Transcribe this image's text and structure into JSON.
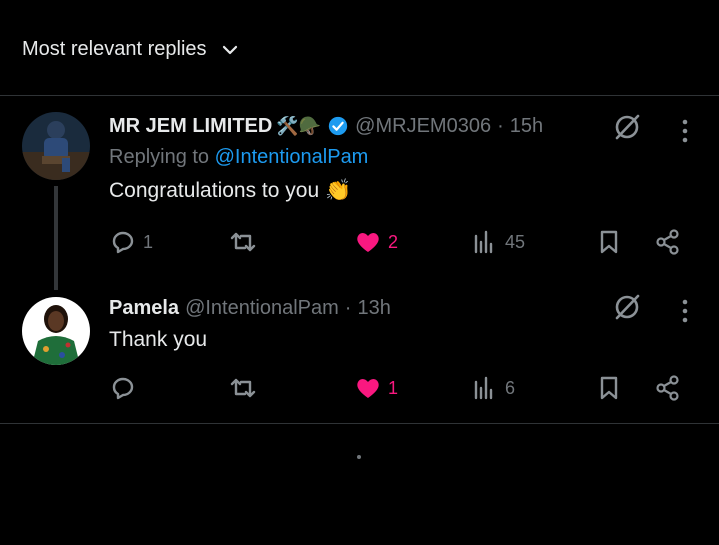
{
  "sort": {
    "label": "Most relevant replies"
  },
  "replies": [
    {
      "name": "MR JEM LIMITED",
      "name_emoji": "🛠️🪖",
      "handle": "@MRJEM0306",
      "time": "15h",
      "replying_prefix": "Replying to",
      "replying_to": "@IntentionalPam",
      "text": "Congratulations to you 👏",
      "reply_count": "1",
      "retweet_count": "",
      "like_count": "2",
      "view_count": "45"
    },
    {
      "name": "Pamela",
      "handle": "@IntentionalPam",
      "time": "13h",
      "text": "Thank you",
      "reply_count": "",
      "retweet_count": "",
      "like_count": "1",
      "view_count": "6"
    }
  ],
  "colors": {
    "background": "#000000",
    "text": "#e7e9ea",
    "muted": "#71767b",
    "link": "#1d9bf0",
    "like": "#f91880",
    "divider": "#2f3336"
  }
}
